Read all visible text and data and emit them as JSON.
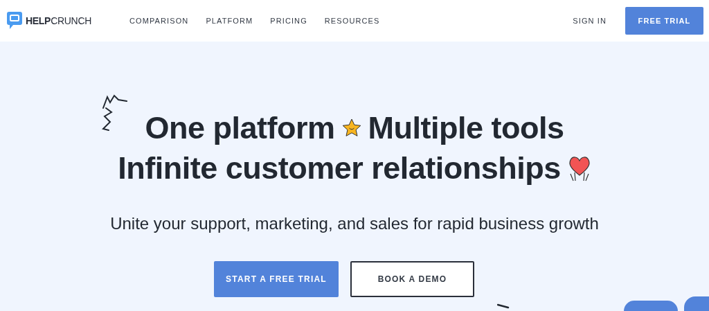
{
  "header": {
    "logo": "**HELP**CRUNCH",
    "nav": [
      {
        "label": "COMPARISON"
      },
      {
        "label": "PLATFORM"
      },
      {
        "label": "PRICING"
      },
      {
        "label": "RESOURCES"
      }
    ],
    "sign_in": "SIGN IN",
    "cta": "FREE TRIAL"
  },
  "hero": {
    "line_1": [
      "One platform",
      "Multiple tools"
    ],
    "line_2": "Infinite customer relationships",
    "subtitle": "Unite your support, marketing, and sales for rapid business growth",
    "buttons": [
      {
        "label": "START A FREE TRIAL",
        "kind": "primary"
      },
      {
        "label": "BOOK A DEMO",
        "kind": "outline"
      }
    ]
  }
}
